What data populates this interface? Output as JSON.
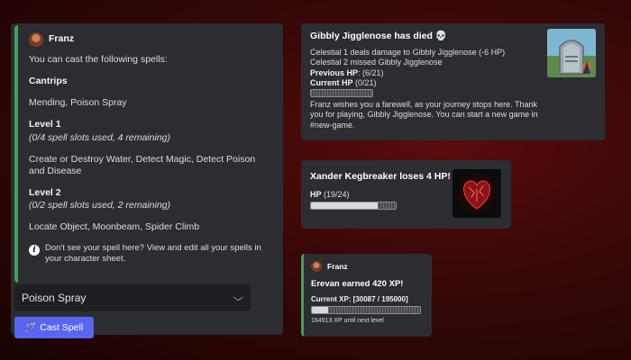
{
  "spell_panel": {
    "author": "Franz",
    "intro": "You can cast the following spells:",
    "cantrips_heading": "Cantrips",
    "cantrips_list": "Mending, Poison Spray",
    "level1_heading": "Level 1",
    "level1_slots": "(0/4 spell slots used, 4 remaining)",
    "level1_list": "Create or Destroy Water, Detect Magic, Detect Poison and Disease",
    "level2_heading": "Level 2",
    "level2_slots": "(0/2 spell slots used, 2 remaining)",
    "level2_list": "Locate Object, Moonbeam, Spider Climb",
    "note": "Don't see your spell here? View and edit all your spells in your character sheet."
  },
  "spell_select": {
    "selected": "Poison Spray"
  },
  "cast_button": {
    "label": "Cast Spell"
  },
  "death_embed": {
    "title": "Gibbly Jigglenose has died 💀",
    "line1": "Celestial 1 deals damage to Gibbly Jigglenose (-6 HP)",
    "line2": "Celestial 2 missed Gibbly Jigglenose",
    "prev_hp_label": "Previous HP",
    "prev_hp_value": ": (6/21)",
    "curr_hp_label": "Current HP",
    "curr_hp_value": " (0/21)",
    "hp_fraction": 0,
    "farewell": "Franz wishes you a farewell, as your journey stops here. Thank you for playing, Gibbly Jigglenose. You can start a new game in #new-game."
  },
  "hp_embed": {
    "title": "Xander Kegbreaker loses 4 HP!",
    "hp_label": "HP",
    "hp_value": " (19/24)",
    "hp_fraction": 0.79
  },
  "xp_embed": {
    "author": "Franz",
    "title": "Erevan earned 420 XP!",
    "current_label": "Current XP: [30087 / 195000]",
    "xp_fraction": 0.15,
    "remaining": "164913 XP until next level"
  },
  "colors": {
    "accent_green": "#3ba55c",
    "blurple": "#5865f2",
    "embed_bg": "#2b2d31"
  },
  "icons": [
    "info-icon",
    "chevron-down-icon",
    "magic-wand-icon",
    "skull-icon"
  ]
}
